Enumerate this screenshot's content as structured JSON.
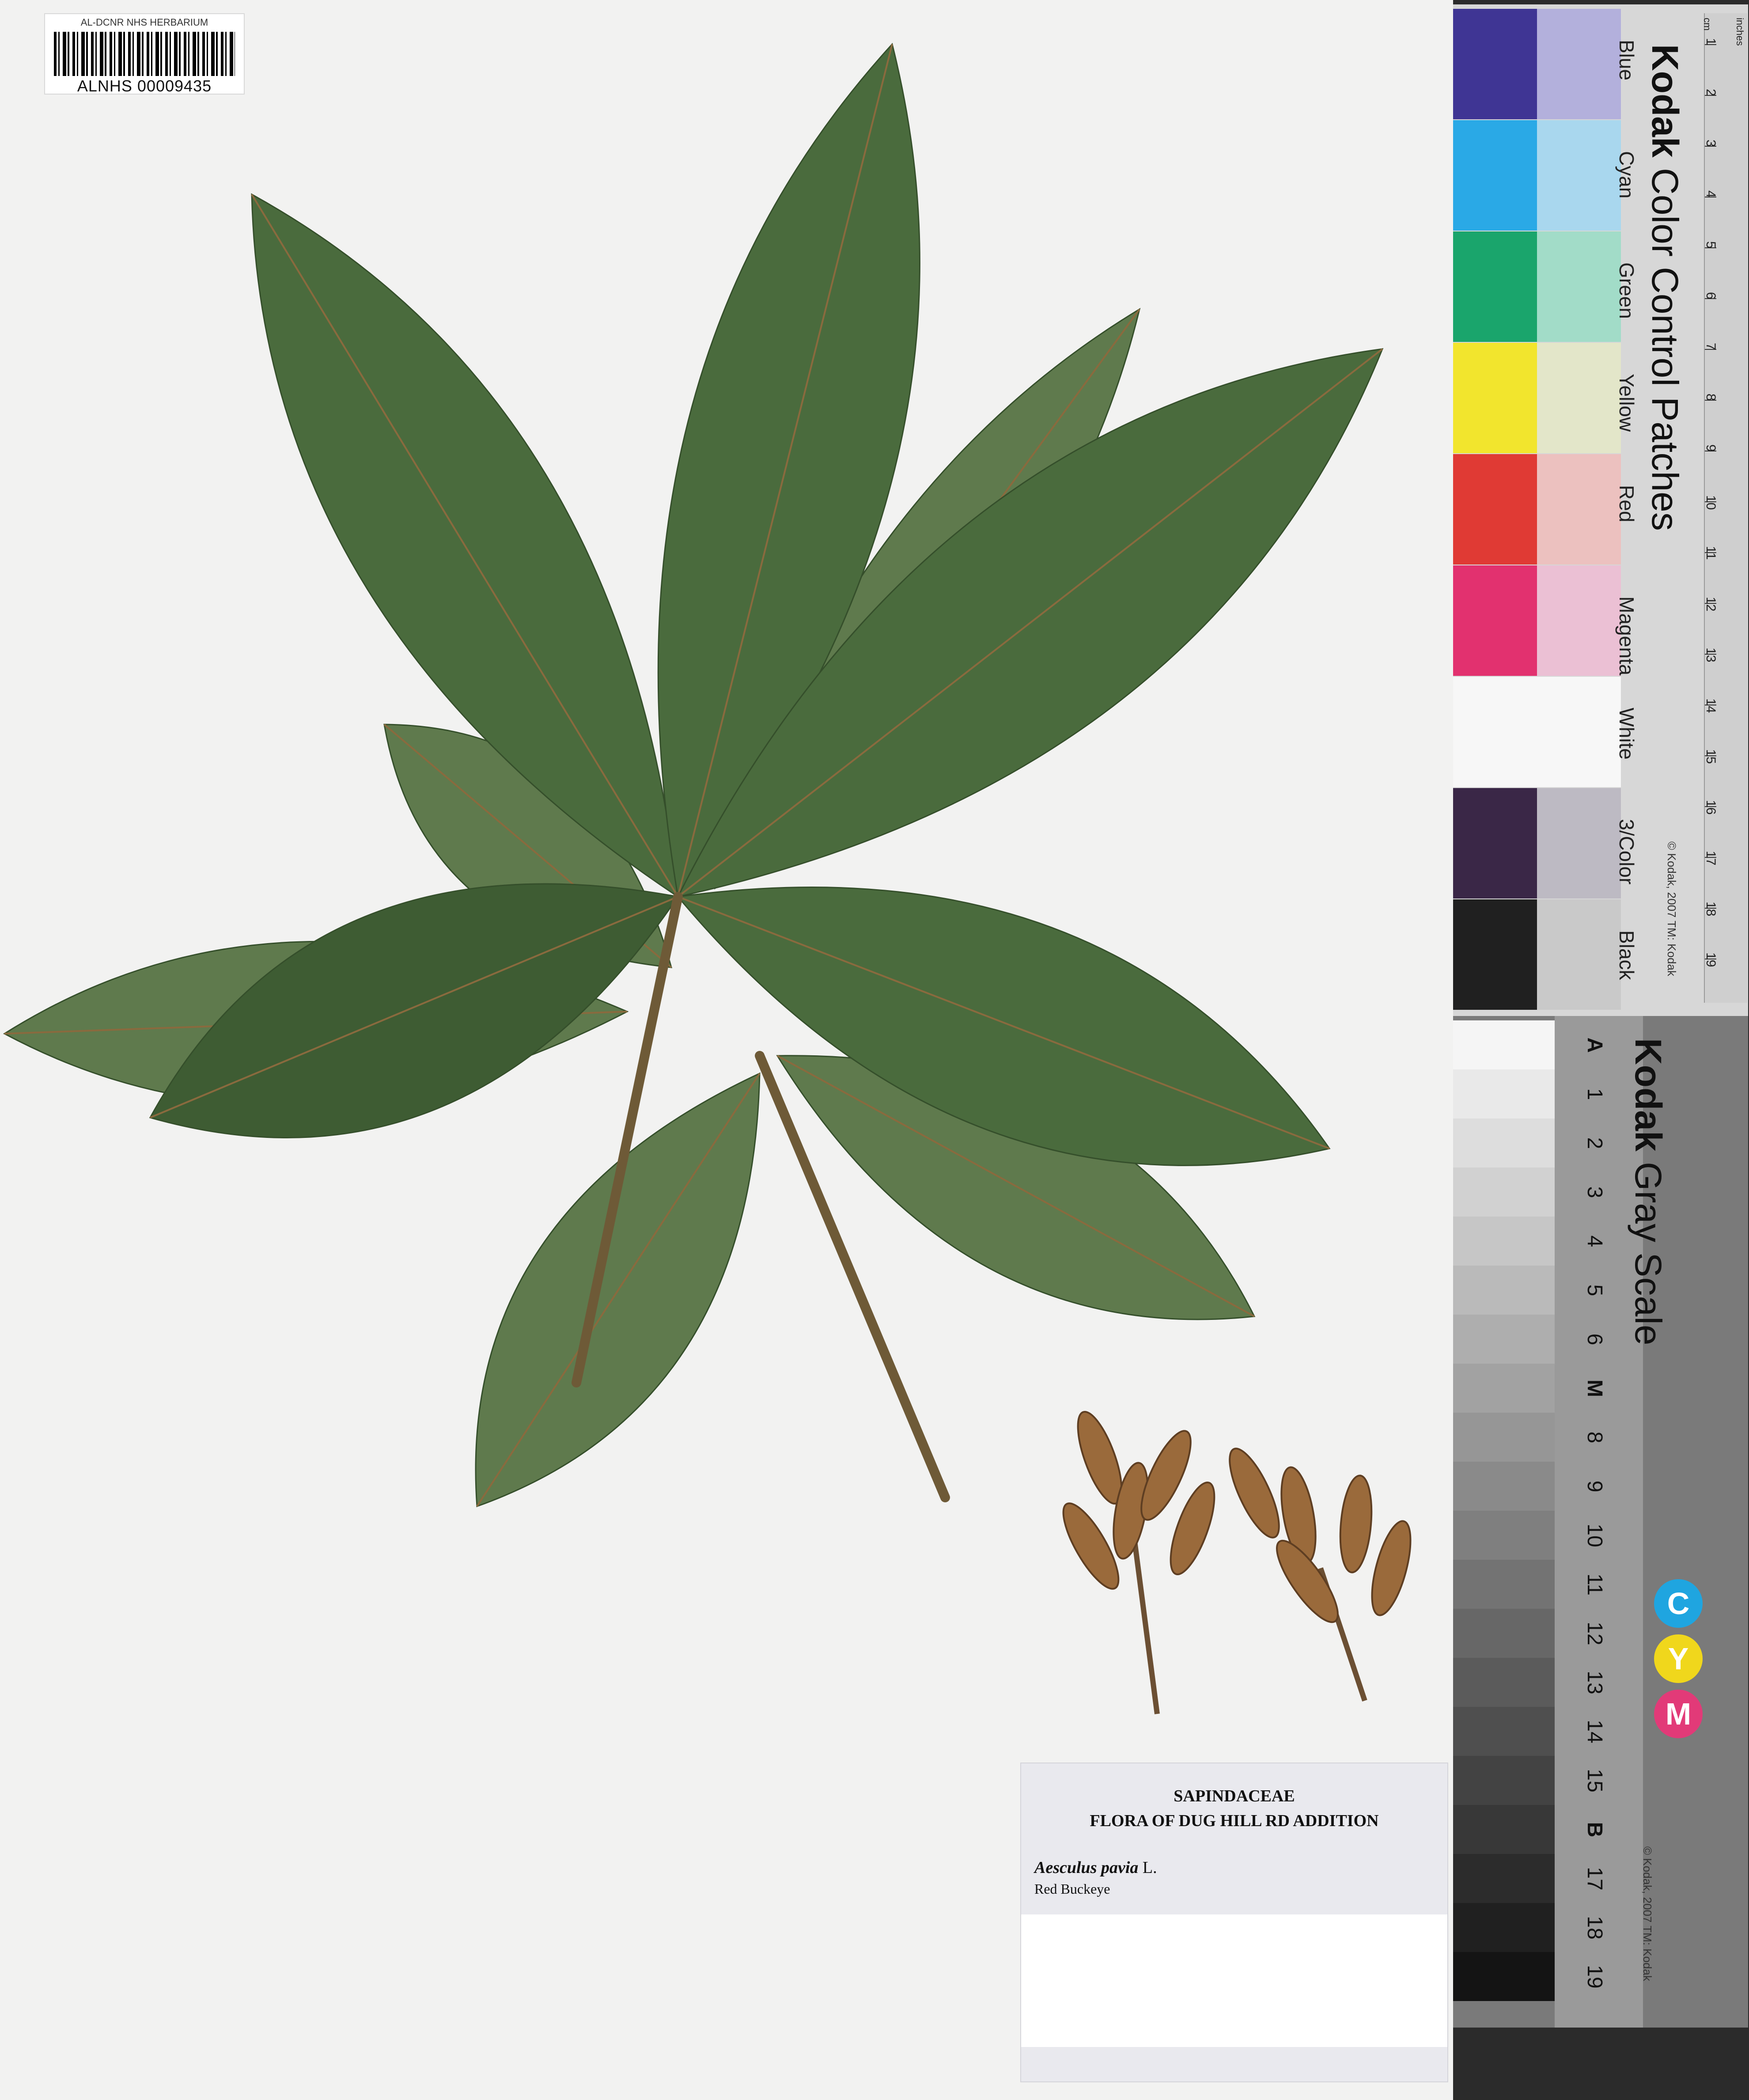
{
  "barcode_label": {
    "institution": "AL-DCNR NHS HERBARIUM",
    "catalog_number": "ALNHS 00009435"
  },
  "specimen_label": {
    "family": "SAPINDACEAE",
    "collection": "FLORA OF DUG HILL RD ADDITION",
    "scientific_name": "Aesculus pavia",
    "authority": "L.",
    "common_name": "Red Buckeye"
  },
  "color_strip": {
    "brand": "Kodak",
    "title_rest": "Color Control Patches",
    "copyright": "© Kodak, 2007 TM: Kodak",
    "ruler_units": [
      "cm",
      "inches"
    ],
    "patches": [
      {
        "name": "Blue",
        "dark": "#3f3594",
        "light": "#b3b0dc"
      },
      {
        "name": "Cyan",
        "dark": "#2aa9e6",
        "light": "#a9d7ee"
      },
      {
        "name": "Green",
        "dark": "#1aa56c",
        "light": "#a2dcc8"
      },
      {
        "name": "Yellow",
        "dark": "#f2e52d",
        "light": "#e3e6c9"
      },
      {
        "name": "Red",
        "dark": "#e03a34",
        "light": "#ecc1bf"
      },
      {
        "name": "Magenta",
        "dark": "#e2316f",
        "light": "#ebc0d4"
      },
      {
        "name": "White",
        "dark": "#f7f7f7",
        "light": "#f7f7f7"
      },
      {
        "name": "3/Color",
        "dark": "#3a2747",
        "light": "#bdbac3"
      },
      {
        "name": "Black",
        "dark": "#202020",
        "light": "#c9c9c9"
      }
    ],
    "ruler_numbers": [
      "1",
      "2",
      "3",
      "4",
      "5",
      "6",
      "7",
      "8",
      "9",
      "10",
      "11",
      "12",
      "13",
      "14",
      "15",
      "16",
      "17",
      "18",
      "19"
    ]
  },
  "gray_scale": {
    "brand": "Kodak",
    "title_rest": "Gray Scale",
    "copyright": "© Kodak, 2007 TM: Kodak",
    "steps": [
      "A",
      "1",
      "2",
      "3",
      "4",
      "5",
      "6",
      "M",
      "8",
      "9",
      "10",
      "11",
      "12",
      "13",
      "14",
      "15",
      "B",
      "17",
      "18",
      "19"
    ],
    "cmy": [
      {
        "letter": "C",
        "color": "#1fa5e0"
      },
      {
        "letter": "Y",
        "color": "#f0d71c"
      },
      {
        "letter": "M",
        "color": "#e23a78"
      }
    ]
  },
  "colors": {
    "leaf": "#4a6b3d",
    "leaf_dark": "#3e5c33",
    "leaf_back": "#5f7a4d",
    "petiole": "#6e5a37",
    "flower": "#9a6a3b"
  }
}
